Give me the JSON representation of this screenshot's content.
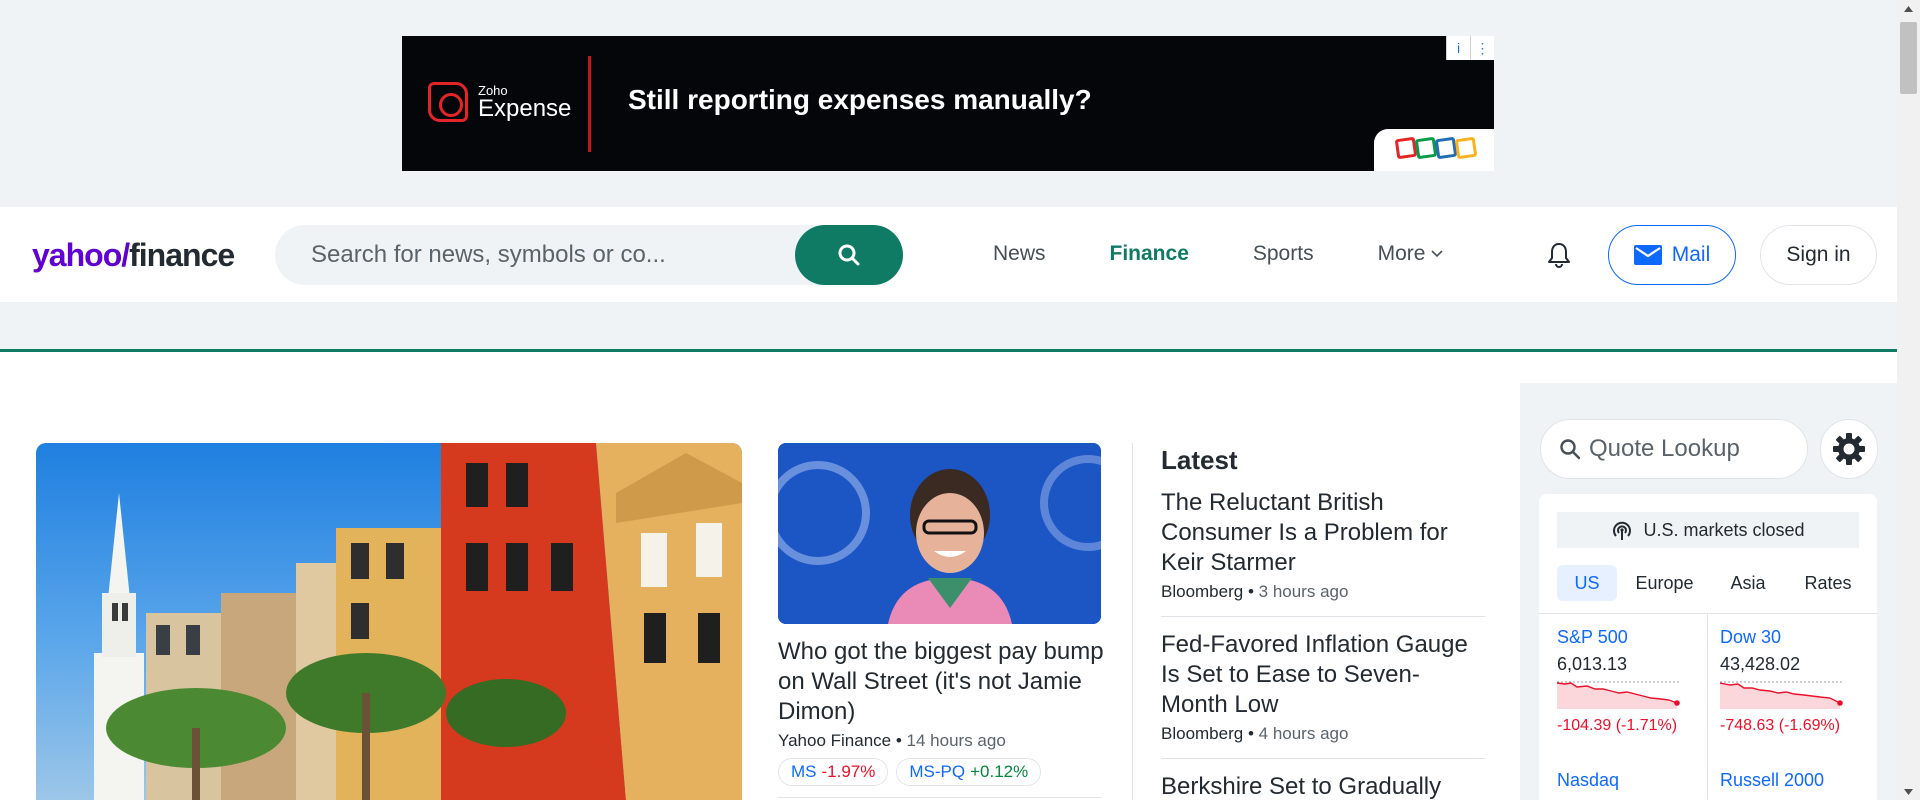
{
  "ad": {
    "brand_small": "Zoho",
    "brand_big": "Expense",
    "headline": "Still reporting expenses manually?",
    "info_glyph": "i",
    "menu_glyph": "⋮"
  },
  "header": {
    "brand_yahoo": "yahoo/",
    "brand_finance": "finance",
    "search_placeholder": "Search for news, symbols or co...",
    "nav": {
      "news": "News",
      "finance": "Finance",
      "sports": "Sports",
      "more": "More"
    },
    "mail_label": "Mail",
    "signin_label": "Sign in",
    "accent_color": "#0f7b64",
    "brand_color": "#6001d2"
  },
  "feature": {
    "title": "Who got the biggest pay bump on Wall Street (it's not Jamie Dimon)",
    "source": "Yahoo Finance",
    "time": "14 hours ago",
    "tickers": [
      {
        "symbol": "MS",
        "change": "-1.97%"
      },
      {
        "symbol": "MS-PQ",
        "change": "+0.12%"
      }
    ]
  },
  "latest": {
    "heading": "Latest",
    "stories": [
      {
        "title": "The Reluctant British Consumer Is a Problem for Keir Starmer",
        "source": "Bloomberg",
        "time": "3 hours ago"
      },
      {
        "title": "Fed-Favored Inflation Gauge Is Set to Ease to Seven-Month Low",
        "source": "Bloomberg",
        "time": "4 hours ago"
      },
      {
        "title": "Berkshire Set to Gradually",
        "source": "",
        "time": ""
      }
    ]
  },
  "markets": {
    "lookup_placeholder": "Quote Lookup",
    "status": "U.S. markets closed",
    "tabs": [
      "US",
      "Europe",
      "Asia",
      "Rates"
    ],
    "indices": [
      {
        "name": "S&P 500",
        "price": "6,013.13",
        "change": "-104.39",
        "pct": "(-1.71%)"
      },
      {
        "name": "Dow 30",
        "price": "43,428.02",
        "change": "-748.63",
        "pct": "(-1.69%)"
      },
      {
        "name": "Nasdaq",
        "price": "",
        "change": "",
        "pct": ""
      },
      {
        "name": "Russell 2000",
        "price": "",
        "change": "",
        "pct": ""
      }
    ],
    "down_color": "#eb0f29"
  }
}
